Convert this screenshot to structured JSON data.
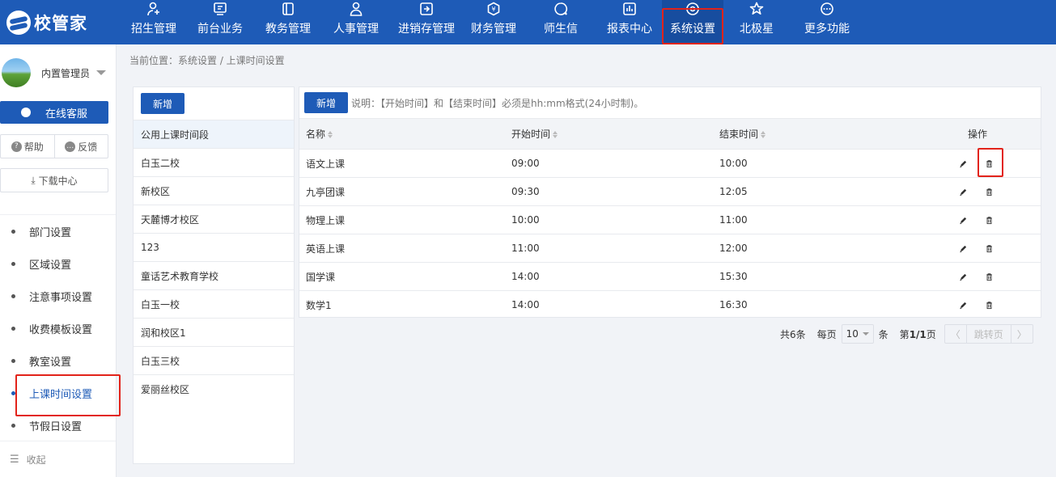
{
  "app": {
    "logo_text": "校管家"
  },
  "nav": [
    {
      "label": "招生管理",
      "icon": "person-add-icon"
    },
    {
      "label": "前台业务",
      "icon": "monitor-icon"
    },
    {
      "label": "教务管理",
      "icon": "book-icon"
    },
    {
      "label": "人事管理",
      "icon": "user-icon"
    },
    {
      "label": "进销存管理",
      "icon": "inventory-icon"
    },
    {
      "label": "财务管理",
      "icon": "yen-icon"
    },
    {
      "label": "师生信",
      "icon": "chat-icon"
    },
    {
      "label": "报表中心",
      "icon": "bar-chart-icon"
    },
    {
      "label": "系统设置",
      "icon": "settings-icon",
      "active": true
    },
    {
      "label": "北极星",
      "icon": "star-icon"
    },
    {
      "label": "更多功能",
      "icon": "more-icon"
    }
  ],
  "sidebar": {
    "user_name": "内置管理员",
    "kefu_label": "在线客服",
    "help_label": "帮助",
    "feedback_label": "反馈",
    "download_label": "下载中心",
    "items": [
      {
        "label": "部门设置"
      },
      {
        "label": "区域设置"
      },
      {
        "label": "注意事项设置"
      },
      {
        "label": "收费模板设置"
      },
      {
        "label": "教室设置"
      },
      {
        "label": "上课时间设置",
        "active": true
      },
      {
        "label": "节假日设置"
      }
    ],
    "collapse_label": "收起"
  },
  "breadcrumb": "当前位置：系统设置 / 上课时间设置",
  "campus_panel": {
    "add_label": "新增",
    "items": [
      "公用上课时间段",
      "白玉二校",
      "新校区",
      "天麓博才校区",
      "123",
      "童话艺术教育学校",
      "白玉一校",
      "润和校区1",
      "白玉三校",
      "爱丽丝校区"
    ]
  },
  "time_panel": {
    "add_label": "新增",
    "note": "说明：【开始时间】和【结束时间】必须是hh:mm格式(24小时制)。",
    "columns": {
      "name": "名称",
      "start": "开始时间",
      "end": "结束时间",
      "ops": "操作"
    },
    "rows": [
      {
        "name": "语文上课",
        "start": "09:00",
        "end": "10:00"
      },
      {
        "name": "九亭团课",
        "start": "09:30",
        "end": "12:05"
      },
      {
        "name": "物理上课",
        "start": "10:00",
        "end": "11:00"
      },
      {
        "name": "英语上课",
        "start": "11:00",
        "end": "12:00"
      },
      {
        "name": "国学课",
        "start": "14:00",
        "end": "15:30"
      },
      {
        "name": "数学1",
        "start": "14:00",
        "end": "16:30"
      }
    ]
  },
  "pager": {
    "total_text": "共6条",
    "per_page_prefix": "每页",
    "per_page_value": "10",
    "per_page_suffix": "条",
    "page_prefix": "第",
    "page_value": "1/1",
    "page_suffix": "页",
    "jump_label": "跳转页"
  }
}
